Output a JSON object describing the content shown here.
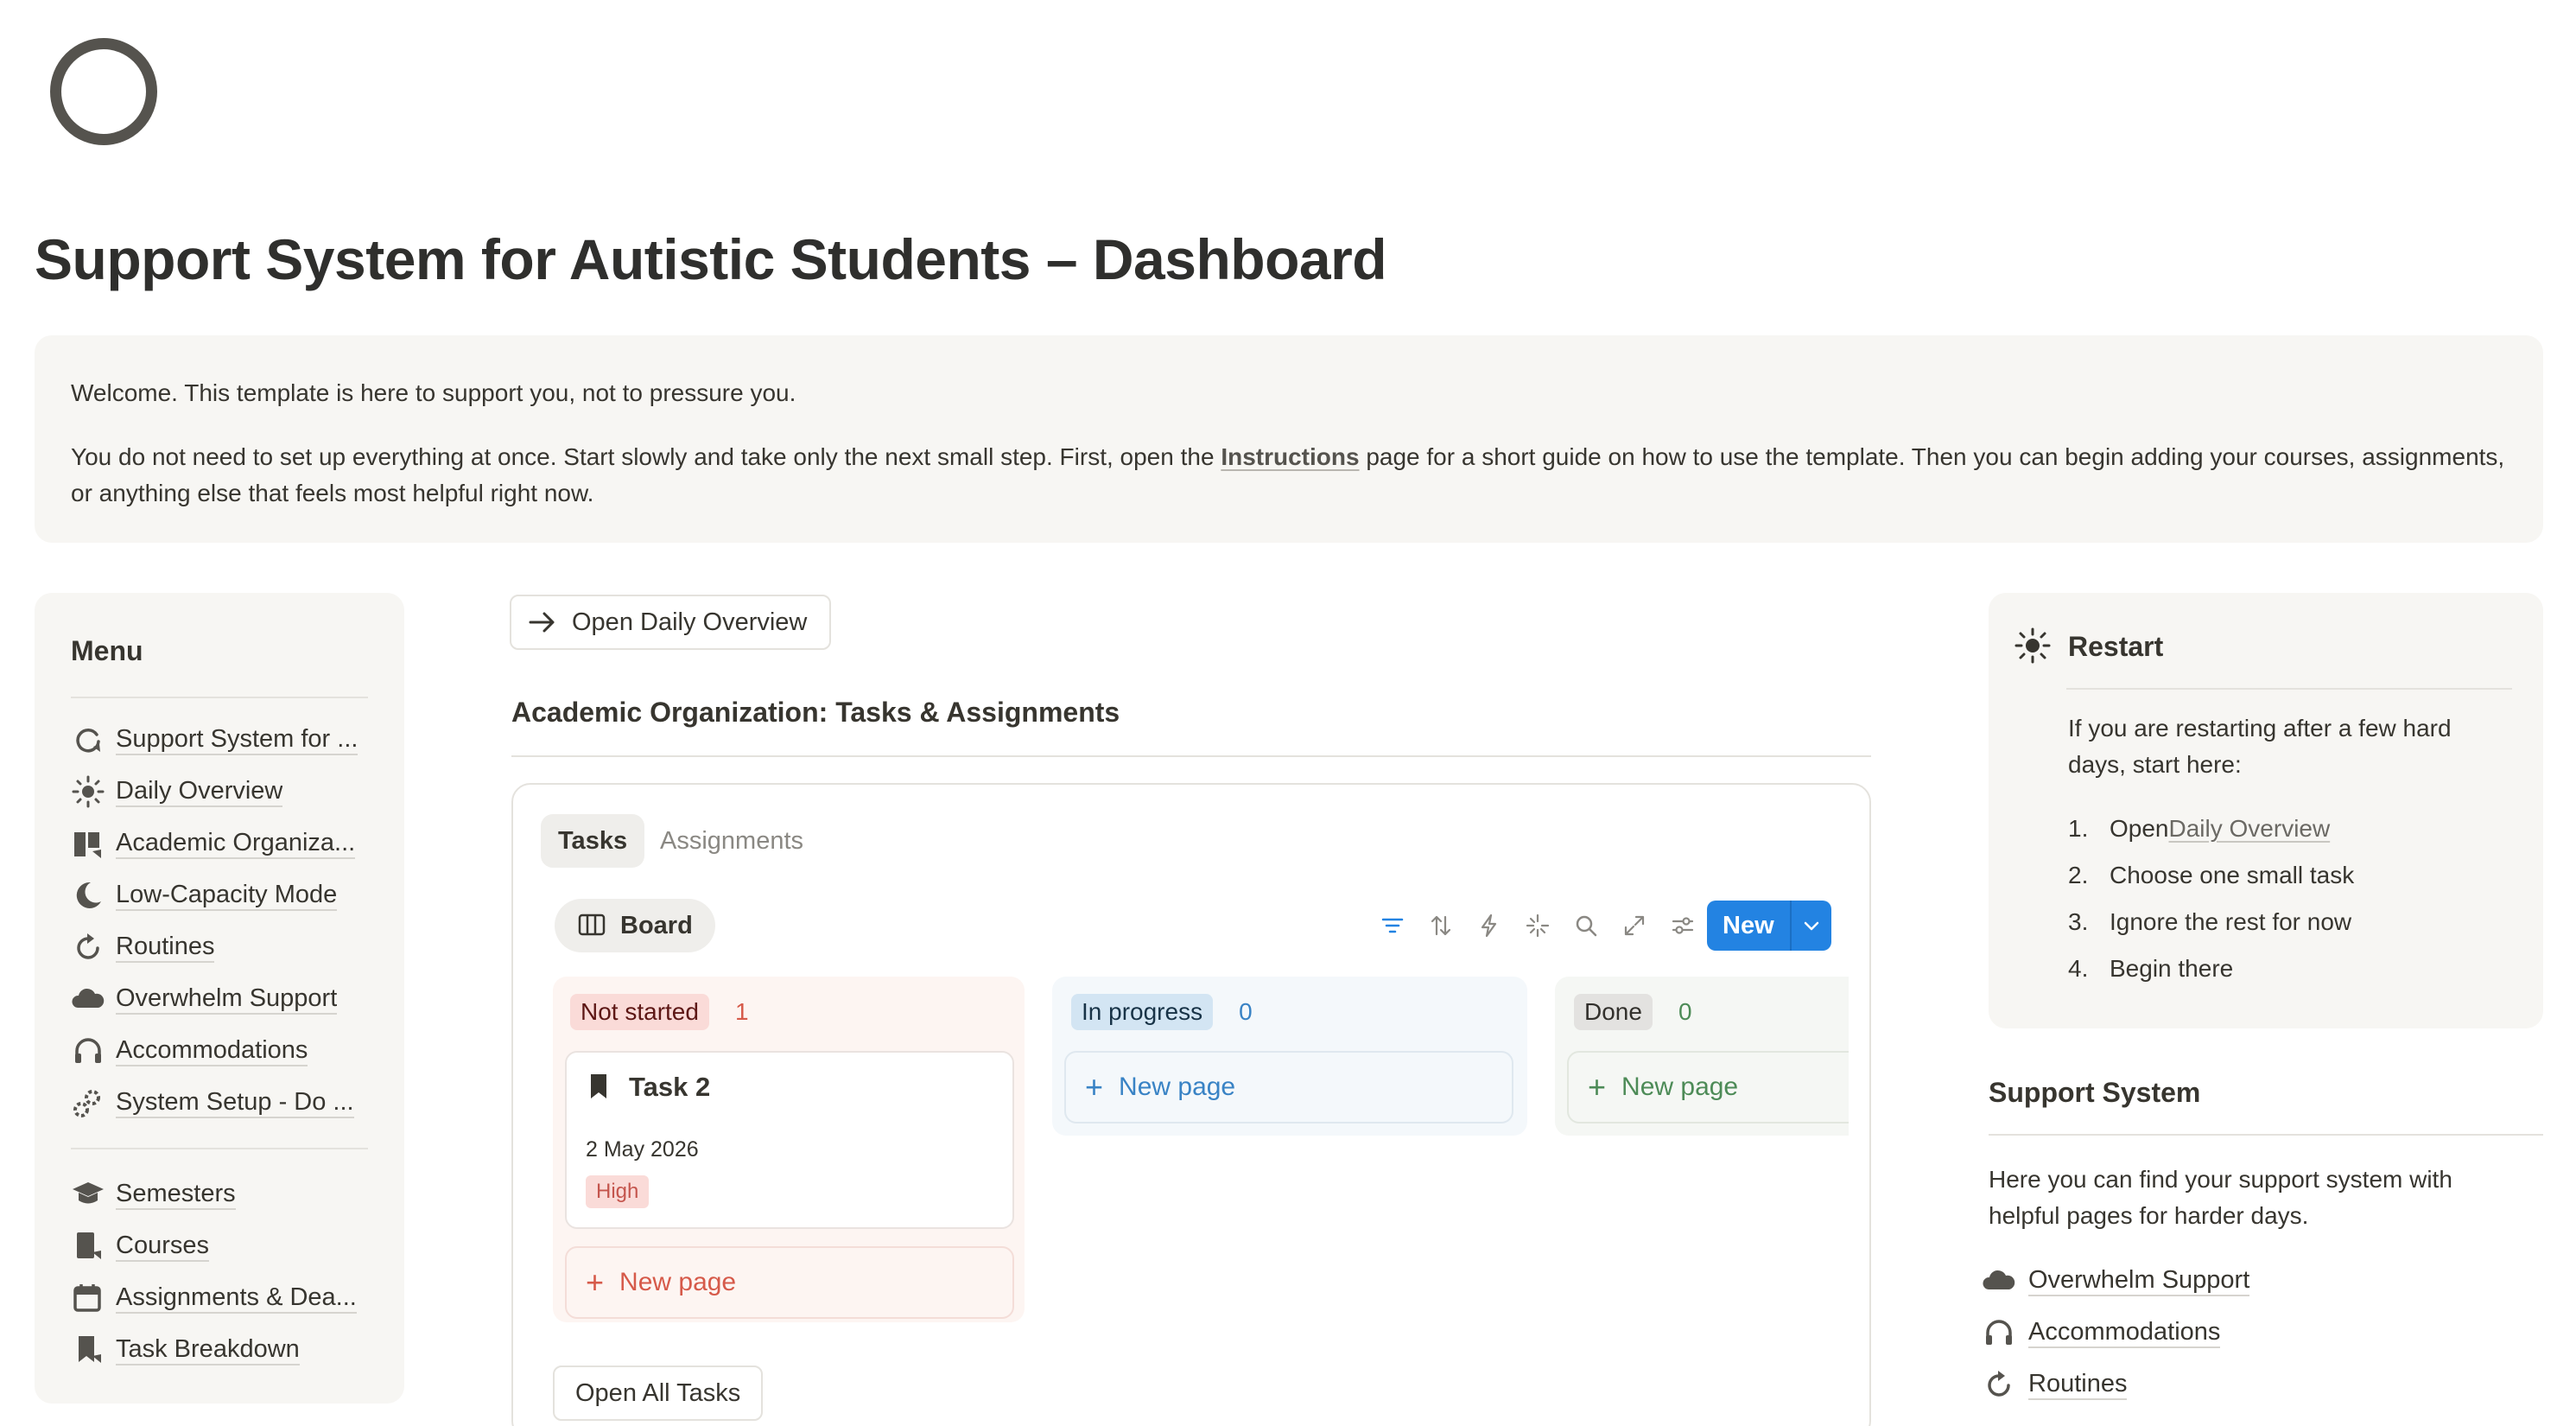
{
  "page": {
    "icon": "circle-icon",
    "title": "Support System for Autistic Students – Dashboard"
  },
  "callout": {
    "line1": "Welcome. This template is here to support you, not to pressure you.",
    "line2_pre": "You do not need to set up everything at once. Start slowly and take only the next small step. First, open the ",
    "line2_link": "Instructions",
    "line2_post": " page for a short guide on how to use the template. Then you can begin adding your courses, assignments, or anything else that feels most helpful right now."
  },
  "menu": {
    "title": "Menu",
    "group1": [
      {
        "label": "Support System for ...",
        "icon": "circle-arrow-icon"
      },
      {
        "label": "Daily Overview",
        "icon": "sun-icon"
      },
      {
        "label": "Academic Organiza...",
        "icon": "book-icon"
      },
      {
        "label": "Low-Capacity Mode",
        "icon": "moon-icon"
      },
      {
        "label": "Routines",
        "icon": "refresh-icon"
      },
      {
        "label": "Overwhelm Support",
        "icon": "cloud-icon"
      },
      {
        "label": "Accommodations",
        "icon": "headphones-icon"
      },
      {
        "label": "System Setup - Do ...",
        "icon": "gears-icon"
      }
    ],
    "group2": [
      {
        "label": "Semesters",
        "icon": "graduation-cap-icon"
      },
      {
        "label": "Courses",
        "icon": "notebook-icon"
      },
      {
        "label": "Assignments & Dea...",
        "icon": "calendar-icon"
      },
      {
        "label": "Task Breakdown",
        "icon": "bookmark-icon"
      }
    ]
  },
  "center": {
    "open_daily_label": "Open Daily Overview",
    "section_title": "Academic Organization: Tasks & Assignments",
    "tabs": [
      "Tasks",
      "Assignments"
    ],
    "view_label": "Board",
    "new_label": "New",
    "columns": [
      {
        "status": "Not started",
        "count": "1",
        "new_page": "New page"
      },
      {
        "status": "In progress",
        "count": "0",
        "new_page": "New page"
      },
      {
        "status": "Done",
        "count": "0",
        "new_page": "New page"
      }
    ],
    "task": {
      "title": "Task 2",
      "date": "2 May 2026",
      "priority": "High"
    },
    "open_all_label": "Open All Tasks"
  },
  "restart": {
    "title": "Restart",
    "text": "If you are restarting after a few hard days, start here:",
    "steps": [
      {
        "num": "1.",
        "pre": "Open ",
        "link": "Daily Overview"
      },
      {
        "num": "2.",
        "pre": "Choose one small task",
        "link": ""
      },
      {
        "num": "3.",
        "pre": "Ignore the rest for now",
        "link": ""
      },
      {
        "num": "4.",
        "pre": "Begin there",
        "link": ""
      }
    ]
  },
  "support": {
    "title": "Support System",
    "text": "Here you can find your support system with helpful pages for harder days.",
    "items": [
      {
        "label": "Overwhelm Support",
        "icon": "cloud-icon"
      },
      {
        "label": "Accommodations",
        "icon": "headphones-icon"
      },
      {
        "label": "Routines",
        "icon": "refresh-icon"
      }
    ]
  },
  "colors": {
    "accent": "#2383e2",
    "not_started_bg": "#fadbd8",
    "in_progress_bg": "#d3e5f3",
    "done_bg": "#e3e2e0"
  }
}
